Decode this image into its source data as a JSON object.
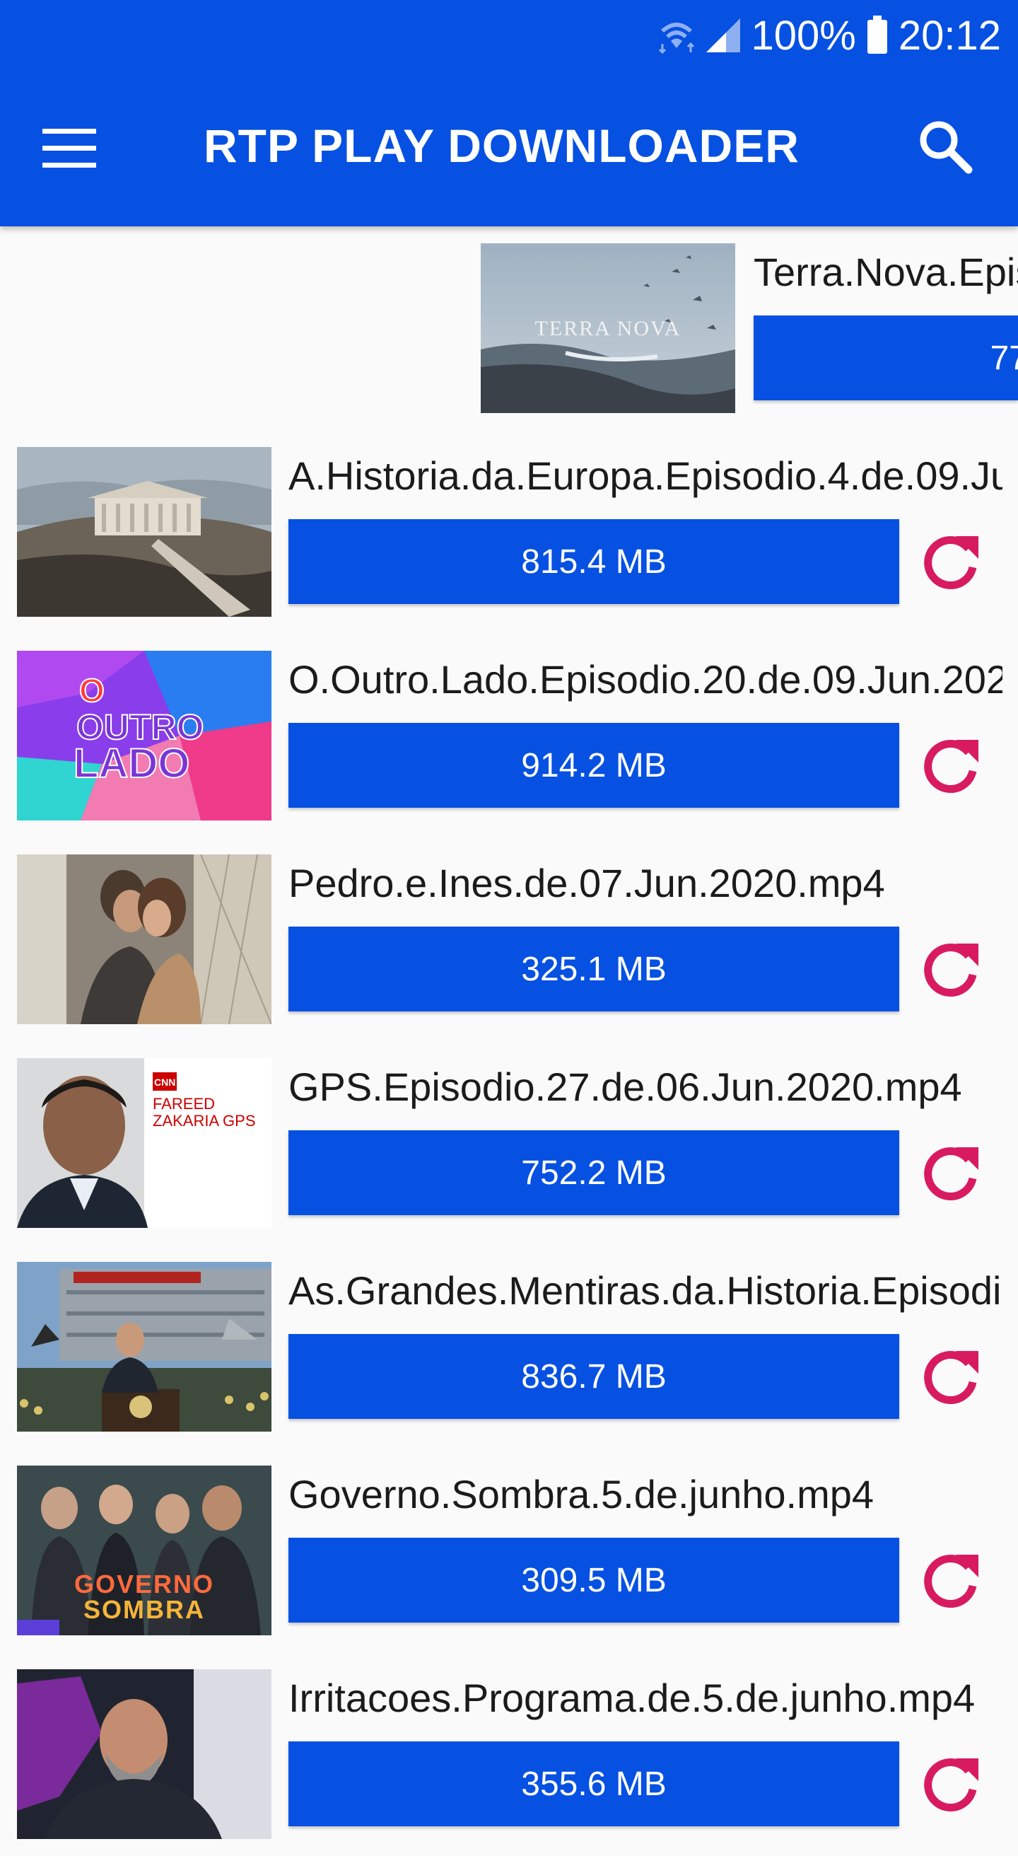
{
  "status_bar": {
    "battery": "100%",
    "time": "20:12"
  },
  "toolbar": {
    "title": "RTP PLAY DOWNLOADER"
  },
  "colors": {
    "primary": "#0650e2",
    "retry": "#d81b60"
  },
  "items": [
    {
      "title": "Terra.Nova.Epis",
      "size": "77",
      "thumb": "terra-nova",
      "thumb_caption": "TERRA NOVA"
    },
    {
      "title": "A.Historia.da.Europa.Episodio.4.de.09.Ju",
      "size": "815.4 MB",
      "thumb": "acropolis"
    },
    {
      "title": "O.Outro.Lado.Episodio.20.de.09.Jun.202",
      "size": "914.2 MB",
      "thumb": "o-outro-lado",
      "thumb_caption": [
        "O",
        "OUTRO",
        "LADO"
      ]
    },
    {
      "title": "Pedro.e.Ines.de.07.Jun.2020.mp4",
      "size": "325.1 MB",
      "thumb": "pedro-ines"
    },
    {
      "title": "GPS.Episodio.27.de.06.Jun.2020.mp4",
      "size": "752.2 MB",
      "thumb": "gps",
      "thumb_caption": [
        "CNN",
        "FAREED",
        "ZAKARIA GPS"
      ]
    },
    {
      "title": "As.Grandes.Mentiras.da.Historia.Episodi",
      "size": "836.7 MB",
      "thumb": "mentiras"
    },
    {
      "title": "Governo.Sombra.5.de.junho.mp4",
      "size": "309.5 MB",
      "thumb": "governo-sombra",
      "thumb_caption": [
        "GOVERNO",
        "SOMBRA"
      ]
    },
    {
      "title": "Irritacoes.Programa.de.5.de.junho.mp4",
      "size": "355.6 MB",
      "thumb": "irritacoes"
    }
  ]
}
